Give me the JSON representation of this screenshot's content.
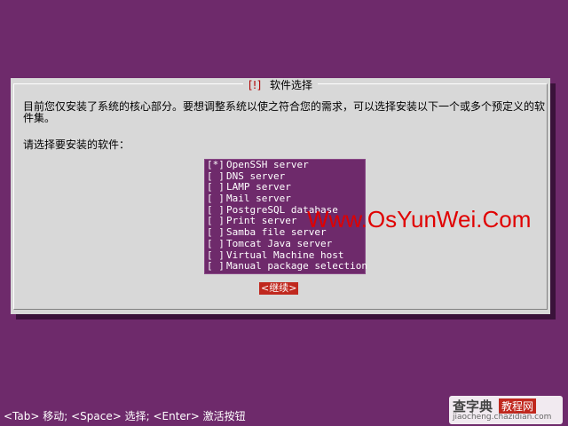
{
  "dialog": {
    "title_open": "[!]",
    "title_text": "软件选择",
    "description": "目前您仅安装了系统的核心部分。要想调整系统以使之符合您的需求，可以选择安装以下一个或多个预定义的软件集。",
    "prompt": "请选择要安装的软件："
  },
  "software_list": [
    {
      "checkbox": "[*]",
      "label": "OpenSSH server"
    },
    {
      "checkbox": "[ ]",
      "label": "DNS server"
    },
    {
      "checkbox": "[ ]",
      "label": "LAMP server"
    },
    {
      "checkbox": "[ ]",
      "label": "Mail server"
    },
    {
      "checkbox": "[ ]",
      "label": "PostgreSQL database"
    },
    {
      "checkbox": "[ ]",
      "label": "Print server"
    },
    {
      "checkbox": "[ ]",
      "label": "Samba file server"
    },
    {
      "checkbox": "[ ]",
      "label": "Tomcat Java server"
    },
    {
      "checkbox": "[ ]",
      "label": "Virtual Machine host"
    },
    {
      "checkbox": "[ ]",
      "label": "Manual package selection"
    }
  ],
  "continue_label": "<继续>",
  "watermark": "Www.OsYunWei.Com",
  "status_bar": "<Tab> 移动; <Space> 选择; <Enter> 激活按钮",
  "logo": {
    "main": "查字典",
    "sub": "教程网",
    "url": "jiaocheng.chazidian.com"
  },
  "colors": {
    "background": "#6e2a6b",
    "dialog": "#d8d8d8",
    "accent": "#c0281e"
  }
}
